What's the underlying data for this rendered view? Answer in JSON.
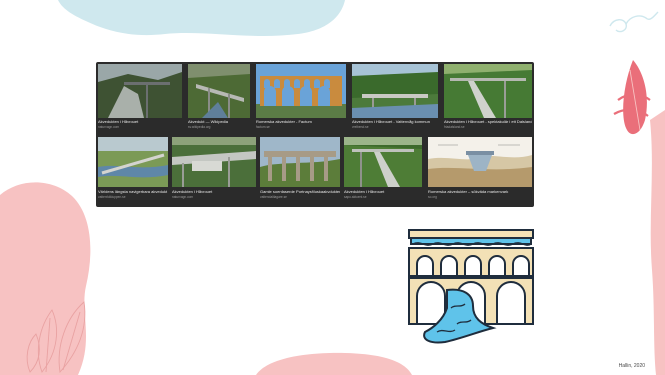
{
  "slide": {
    "credit": "Hallin, 2020"
  },
  "image_results": [
    {
      "caption": "Akvedukten i Håvrouet",
      "source": "naturvagn.com"
    },
    {
      "caption": "Akvedukt — Wikipedia",
      "source": "sv.wikipedia.org"
    },
    {
      "caption": "Romerska akvedukter - Factum",
      "source": "factum.se"
    },
    {
      "caption": "Akvedukten i Håvrouet - Vattenvåg kommun",
      "source": "vrelbend.se"
    },
    {
      "caption": "Akvedukten i Håvrouet - spektakulär i ett Dalsland a…",
      "source": "friadalsland.se"
    },
    {
      "caption": "Världens längsta navigerbara akvedukt",
      "source": "vattenfolkluppen.se"
    },
    {
      "caption": "Akvedukten i Håvrouet",
      "source": "naturvagn.com"
    },
    {
      "caption": "Gamle soenfaserde Portnaysfiluskaakvdukten",
      "source": "vattendaltlagare.se"
    },
    {
      "caption": "Akvedukten i Håvrouet",
      "source": "sapo.aktuent.se"
    },
    {
      "caption": "Romerska akvedukter – sökväda markenvark",
      "source": "so.org"
    }
  ],
  "colors": {
    "grid_bg": "#2b2b2b",
    "blob_blue": "#cfe8ee",
    "blob_pink": "#f7c2c2",
    "leaf_pink": "#ea6f7a",
    "icon_bricks": "#f3e1b6",
    "icon_stroke": "#1f2d3d",
    "icon_water": "#5fc3ea"
  },
  "icons": [
    "aqueduct-icon",
    "leaf-decoration-icon",
    "swirl-decoration-icon"
  ]
}
